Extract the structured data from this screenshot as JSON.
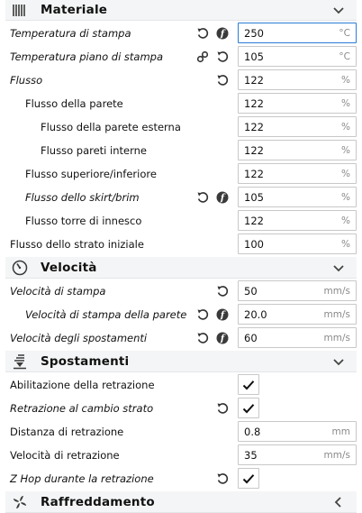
{
  "sections": {
    "materiale": {
      "title": "Materiale",
      "icon": "spool-icon",
      "collapse": "chevron-down-icon"
    },
    "velocita": {
      "title": "Velocità",
      "icon": "gauge-icon",
      "collapse": "chevron-down-icon"
    },
    "spostamenti": {
      "title": "Spostamenti",
      "icon": "travel-icon",
      "collapse": "chevron-down-icon"
    },
    "raffreddamento": {
      "title": "Raffreddamento",
      "icon": "fan-icon",
      "collapse": "chevron-left-icon"
    }
  },
  "settings": {
    "print_temp": {
      "label": "Temperatura di stampa",
      "value": "250",
      "unit": "°C"
    },
    "bed_temp": {
      "label": "Temperatura piano di stampa",
      "value": "105",
      "unit": "°C"
    },
    "flow": {
      "label": "Flusso",
      "value": "122",
      "unit": "%"
    },
    "wall_flow": {
      "label": "Flusso della parete",
      "value": "122",
      "unit": "%"
    },
    "outer_wall_flow": {
      "label": "Flusso della parete esterna",
      "value": "122",
      "unit": "%"
    },
    "inner_wall_flow": {
      "label": "Flusso pareti interne",
      "value": "122",
      "unit": "%"
    },
    "topbottom_flow": {
      "label": "Flusso superiore/inferiore",
      "value": "122",
      "unit": "%"
    },
    "skirt_flow": {
      "label": "Flusso dello skirt/brim",
      "value": "105",
      "unit": "%"
    },
    "prime_tower_flow": {
      "label": "Flusso torre di innesco",
      "value": "122",
      "unit": "%"
    },
    "initial_layer_flow": {
      "label": "Flusso dello strato iniziale",
      "value": "100",
      "unit": "%"
    },
    "print_speed": {
      "label": "Velocità di stampa",
      "value": "50",
      "unit": "mm/s"
    },
    "wall_speed": {
      "label": "Velocità di stampa della parete",
      "value": "20.0",
      "unit": "mm/s"
    },
    "travel_speed": {
      "label": "Velocità degli spostamenti",
      "value": "60",
      "unit": "mm/s"
    },
    "retraction_enable": {
      "label": "Abilitazione della retrazione",
      "checked": true
    },
    "retract_layer_change": {
      "label": "Retrazione al cambio strato",
      "checked": true
    },
    "retraction_distance": {
      "label": "Distanza di retrazione",
      "value": "0.8",
      "unit": "mm"
    },
    "retraction_speed": {
      "label": "Velocità di retrazione",
      "value": "35",
      "unit": "mm/s"
    },
    "z_hop": {
      "label": "Z Hop durante la retrazione",
      "checked": true
    }
  },
  "colors": {
    "focus": "#2a7bd5",
    "icon": "#3a3a3a",
    "field_border": "#c8c8c8"
  }
}
